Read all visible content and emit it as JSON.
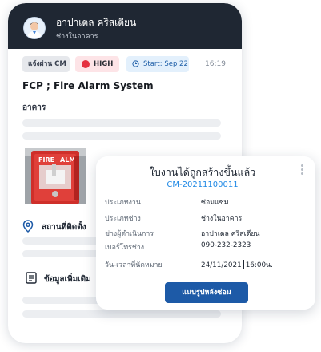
{
  "header": {
    "user_name": "อาปาเตล คริสเตียน",
    "user_role": "ช่างในอาคาร"
  },
  "tags": {
    "type_label": "แจ้งผ่าน CM",
    "priority_label": "HIGH",
    "start_label": "Start: Sep 22"
  },
  "time": "16:19",
  "task": {
    "title": "FCP ; Fire Alarm System",
    "building_label": "อาคาร",
    "location_label": "สถานที่ติดตั้ง",
    "more_info_label": "ข้อมูลเพิ่มเติม"
  },
  "popup": {
    "title": "ใบงานได้ถูกสร้างขึ้นแล้ว",
    "id": "CM-20211100011",
    "rows": [
      {
        "key": "ประเภทงาน",
        "value": "ซ่อมแซม"
      },
      {
        "key": "ประเภทช่าง",
        "value": "ช่างในอาคาร"
      },
      {
        "key": "ช่างผู้ดำเนินการ",
        "value": "อาปาเตล คริสเตียน"
      },
      {
        "key": "เบอร์โทรช่าง",
        "value": "090-232-2323"
      }
    ],
    "appointment_key": "วัน-เวลาที่นัดหมาย",
    "appointment_date": "24/11/2021",
    "appointment_time": "16:00น.",
    "button_label": "แนบรูปหลังซ่อม"
  },
  "colors": {
    "header_bg": "#1f2733",
    "priority_dot": "#e5303f",
    "accent_blue": "#1e88e5",
    "button_bg": "#1d5aa7"
  }
}
